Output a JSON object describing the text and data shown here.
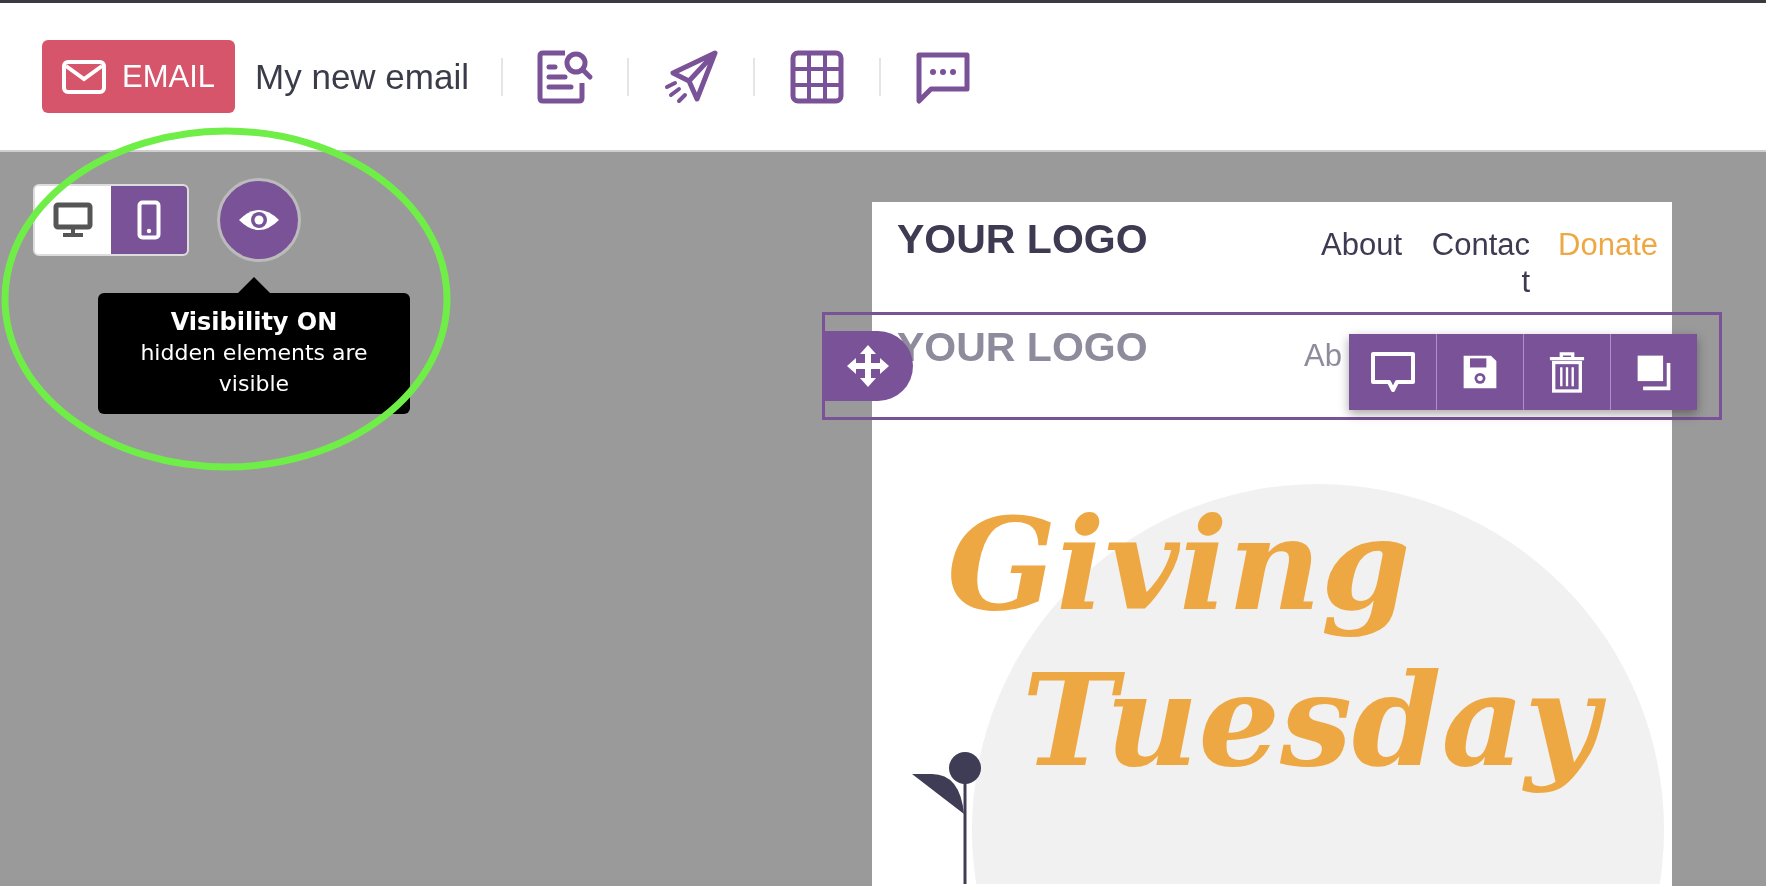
{
  "header": {
    "type_button": {
      "label": "EMAIL"
    },
    "email_name": "My new email",
    "tools": [
      {
        "kind": "preview"
      },
      {
        "kind": "send"
      },
      {
        "kind": "grid"
      },
      {
        "kind": "comments"
      }
    ]
  },
  "device_toggle": [
    {
      "kind": "desktop",
      "selected": false
    },
    {
      "kind": "mobile",
      "selected": true
    }
  ],
  "visibility": {
    "on": true,
    "tooltip_title": "Visibility ON",
    "tooltip_text": "hidden elements are visible"
  },
  "email": {
    "logo": "YOUR LOGO",
    "nav": [
      {
        "label": "About",
        "color": "#3d3a52"
      },
      {
        "label": "Contact",
        "color": "#3d3a52"
      },
      {
        "label": "Donate",
        "color": "#eea843"
      }
    ],
    "hidden_row": {
      "logo": "YOUR LOGO",
      "nav_text": "Ab",
      "actions": [
        {
          "kind": "comment"
        },
        {
          "kind": "save"
        },
        {
          "kind": "delete"
        },
        {
          "kind": "duplicate"
        }
      ]
    },
    "hero": {
      "line_1": "Giving",
      "line_2": "Tuesday"
    }
  }
}
